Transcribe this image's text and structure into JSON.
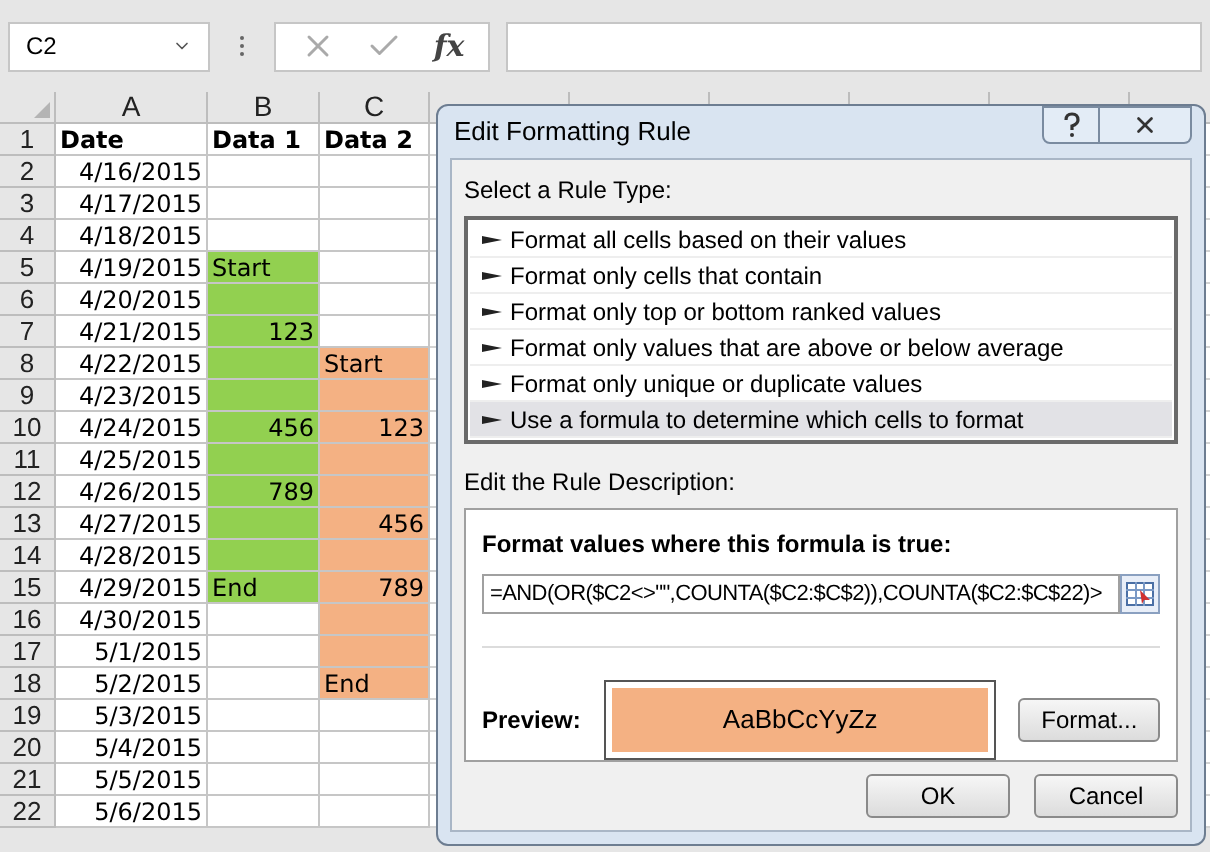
{
  "name_box": {
    "value": "C2"
  },
  "formula_bar": {
    "function_label": "fx"
  },
  "columns": [
    "A",
    "B",
    "C"
  ],
  "rows": [
    {
      "number": "1",
      "cells": [
        {
          "text": "Date",
          "kind": "header"
        },
        {
          "text": "Data 1",
          "kind": "header"
        },
        {
          "text": "Data 2",
          "kind": "header"
        }
      ]
    },
    {
      "number": "2",
      "cells": [
        {
          "text": "4/16/2015",
          "kind": "number"
        },
        {
          "text": "",
          "kind": "text"
        },
        {
          "text": "",
          "kind": "text"
        }
      ]
    },
    {
      "number": "3",
      "cells": [
        {
          "text": "4/17/2015",
          "kind": "number"
        },
        {
          "text": "",
          "kind": "text"
        },
        {
          "text": "",
          "kind": "text"
        }
      ]
    },
    {
      "number": "4",
      "cells": [
        {
          "text": "4/18/2015",
          "kind": "number"
        },
        {
          "text": "",
          "kind": "text"
        },
        {
          "text": "",
          "kind": "text"
        }
      ]
    },
    {
      "number": "5",
      "cells": [
        {
          "text": "4/19/2015",
          "kind": "number"
        },
        {
          "text": "Start",
          "kind": "text",
          "color": "#92d050"
        },
        {
          "text": "",
          "kind": "text"
        }
      ]
    },
    {
      "number": "6",
      "cells": [
        {
          "text": "4/20/2015",
          "kind": "number"
        },
        {
          "text": "",
          "kind": "text",
          "color": "#92d050"
        },
        {
          "text": "",
          "kind": "text"
        }
      ]
    },
    {
      "number": "7",
      "cells": [
        {
          "text": "4/21/2015",
          "kind": "number"
        },
        {
          "text": "123",
          "kind": "number",
          "color": "#92d050"
        },
        {
          "text": "",
          "kind": "text"
        }
      ]
    },
    {
      "number": "8",
      "cells": [
        {
          "text": "4/22/2015",
          "kind": "number"
        },
        {
          "text": "",
          "kind": "text",
          "color": "#92d050"
        },
        {
          "text": "Start",
          "kind": "text",
          "color": "#f4b183"
        }
      ]
    },
    {
      "number": "9",
      "cells": [
        {
          "text": "4/23/2015",
          "kind": "number"
        },
        {
          "text": "",
          "kind": "text",
          "color": "#92d050"
        },
        {
          "text": "",
          "kind": "text",
          "color": "#f4b183"
        }
      ]
    },
    {
      "number": "10",
      "cells": [
        {
          "text": "4/24/2015",
          "kind": "number"
        },
        {
          "text": "456",
          "kind": "number",
          "color": "#92d050"
        },
        {
          "text": "123",
          "kind": "number",
          "color": "#f4b183"
        }
      ]
    },
    {
      "number": "11",
      "cells": [
        {
          "text": "4/25/2015",
          "kind": "number"
        },
        {
          "text": "",
          "kind": "text",
          "color": "#92d050"
        },
        {
          "text": "",
          "kind": "text",
          "color": "#f4b183"
        }
      ]
    },
    {
      "number": "12",
      "cells": [
        {
          "text": "4/26/2015",
          "kind": "number"
        },
        {
          "text": "789",
          "kind": "number",
          "color": "#92d050"
        },
        {
          "text": "",
          "kind": "text",
          "color": "#f4b183"
        }
      ]
    },
    {
      "number": "13",
      "cells": [
        {
          "text": "4/27/2015",
          "kind": "number"
        },
        {
          "text": "",
          "kind": "text",
          "color": "#92d050"
        },
        {
          "text": "456",
          "kind": "number",
          "color": "#f4b183"
        }
      ]
    },
    {
      "number": "14",
      "cells": [
        {
          "text": "4/28/2015",
          "kind": "number"
        },
        {
          "text": "",
          "kind": "text",
          "color": "#92d050"
        },
        {
          "text": "",
          "kind": "text",
          "color": "#f4b183"
        }
      ]
    },
    {
      "number": "15",
      "cells": [
        {
          "text": "4/29/2015",
          "kind": "number"
        },
        {
          "text": "End",
          "kind": "text",
          "color": "#92d050"
        },
        {
          "text": "789",
          "kind": "number",
          "color": "#f4b183"
        }
      ]
    },
    {
      "number": "16",
      "cells": [
        {
          "text": "4/30/2015",
          "kind": "number"
        },
        {
          "text": "",
          "kind": "text"
        },
        {
          "text": "",
          "kind": "text",
          "color": "#f4b183"
        }
      ]
    },
    {
      "number": "17",
      "cells": [
        {
          "text": "5/1/2015",
          "kind": "number"
        },
        {
          "text": "",
          "kind": "text"
        },
        {
          "text": "",
          "kind": "text",
          "color": "#f4b183"
        }
      ]
    },
    {
      "number": "18",
      "cells": [
        {
          "text": "5/2/2015",
          "kind": "number"
        },
        {
          "text": "",
          "kind": "text"
        },
        {
          "text": "End",
          "kind": "text",
          "color": "#f4b183"
        }
      ]
    },
    {
      "number": "19",
      "cells": [
        {
          "text": "5/3/2015",
          "kind": "number"
        },
        {
          "text": "",
          "kind": "text"
        },
        {
          "text": "",
          "kind": "text"
        }
      ]
    },
    {
      "number": "20",
      "cells": [
        {
          "text": "5/4/2015",
          "kind": "number"
        },
        {
          "text": "",
          "kind": "text"
        },
        {
          "text": "",
          "kind": "text"
        }
      ]
    },
    {
      "number": "21",
      "cells": [
        {
          "text": "5/5/2015",
          "kind": "number"
        },
        {
          "text": "",
          "kind": "text"
        },
        {
          "text": "",
          "kind": "text"
        }
      ]
    },
    {
      "number": "22",
      "cells": [
        {
          "text": "5/6/2015",
          "kind": "number"
        },
        {
          "text": "",
          "kind": "text"
        },
        {
          "text": "",
          "kind": "text"
        }
      ]
    }
  ],
  "dialog": {
    "title": "Edit Formatting Rule",
    "rule_type_label": "Select a Rule Type:",
    "rule_types": [
      {
        "label": "Format all cells based on their values",
        "selected": false
      },
      {
        "label": "Format only cells that contain",
        "selected": false
      },
      {
        "label": "Format only top or bottom ranked values",
        "selected": false
      },
      {
        "label": "Format only values that are above or below average",
        "selected": false
      },
      {
        "label": "Format only unique or duplicate values",
        "selected": false
      },
      {
        "label": "Use a formula to determine which cells to format",
        "selected": true
      }
    ],
    "description_label": "Edit the Rule Description:",
    "formula_label": "Format values where this formula is true:",
    "formula": "=AND(OR($C2<>\"\",COUNTA($C2:$C$2)),COUNTA($C2:$C$22)>",
    "preview_label": "Preview:",
    "preview_text": "AaBbCcYyZz",
    "buttons": {
      "format": "Format...",
      "ok": "OK",
      "cancel": "Cancel"
    }
  }
}
